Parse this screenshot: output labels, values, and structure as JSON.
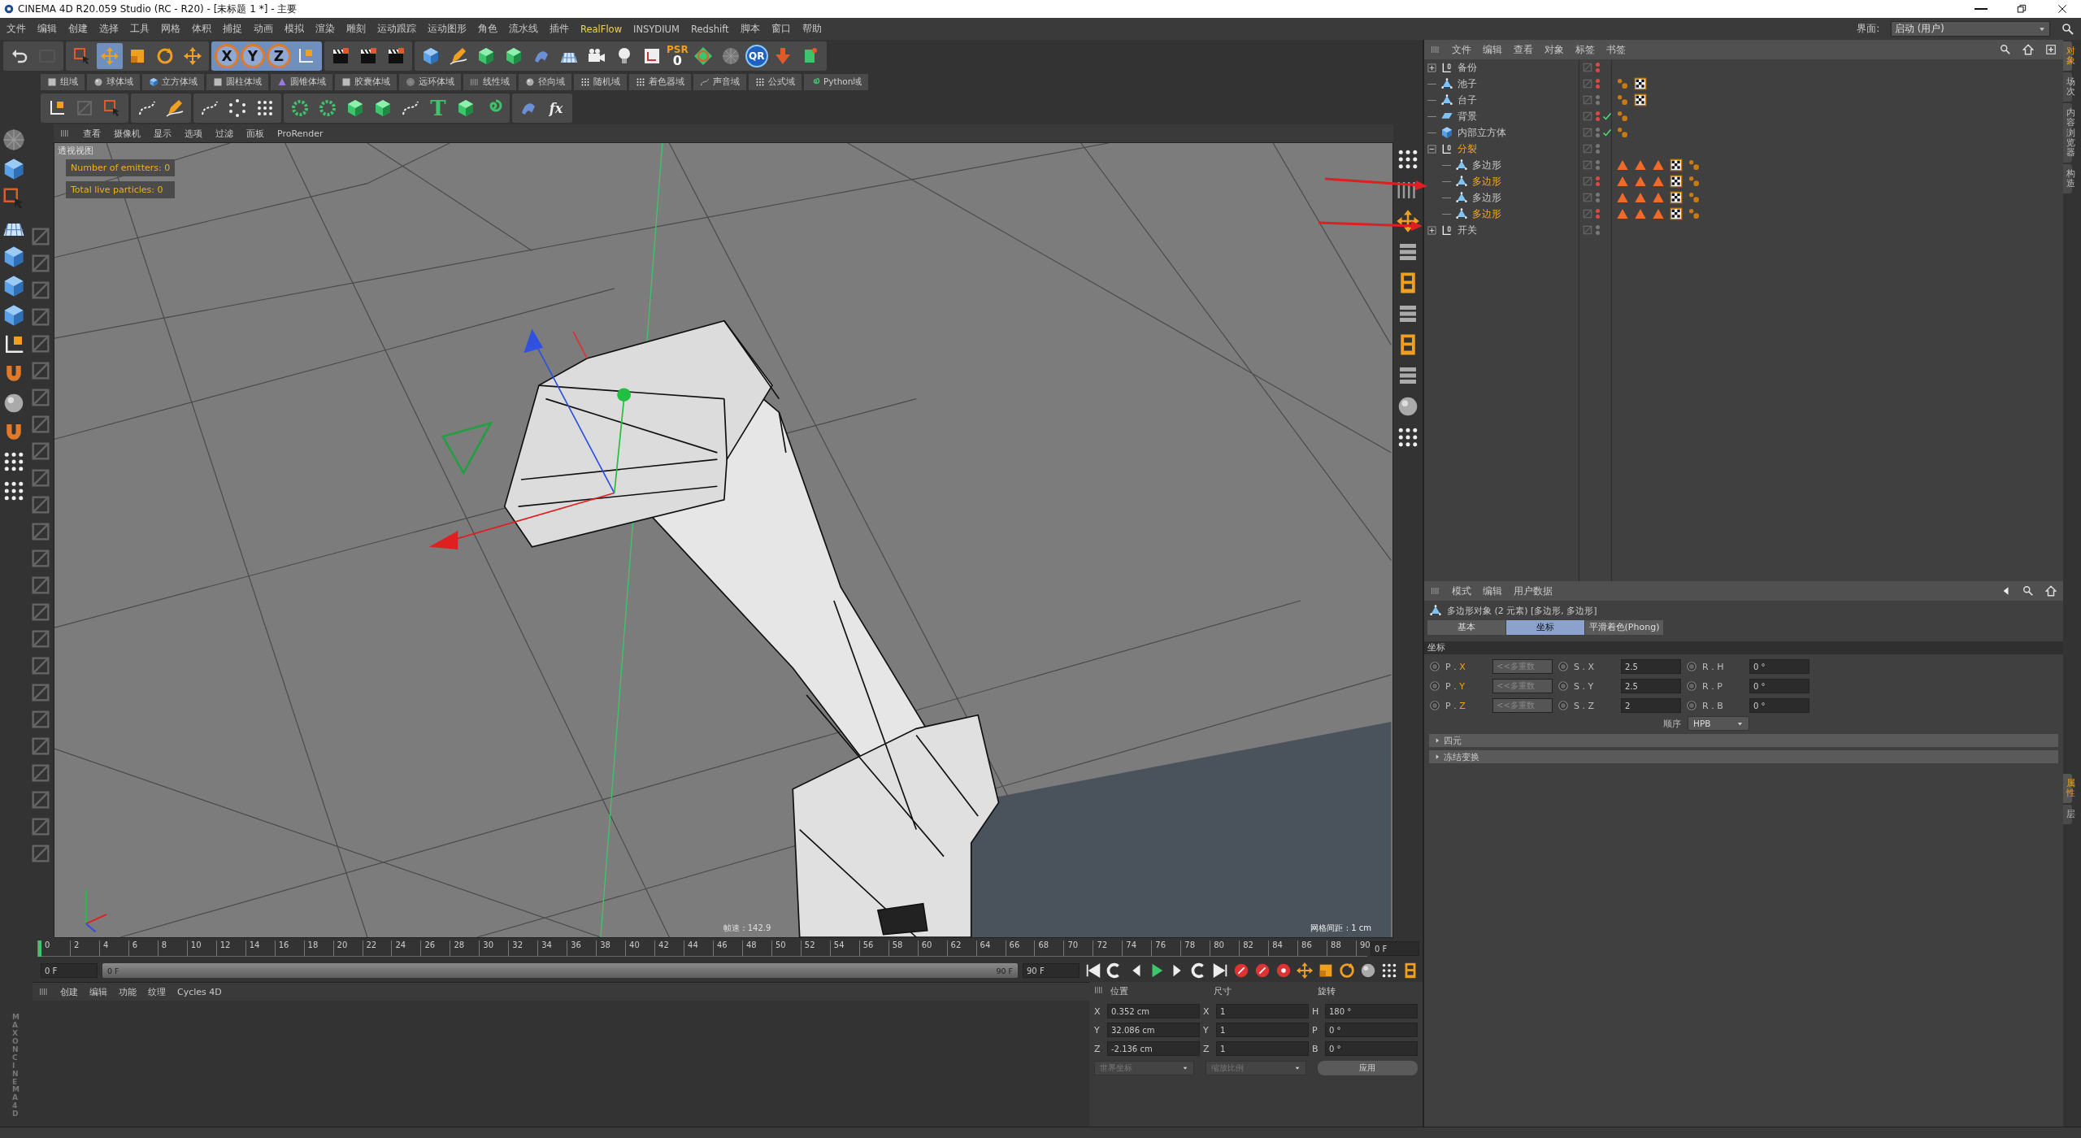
{
  "window": {
    "title": "CINEMA 4D R20.059 Studio (RC - R20) - [未标题 1 *] - 主要"
  },
  "menu": [
    "文件",
    "编辑",
    "创建",
    "选择",
    "工具",
    "网格",
    "体积",
    "捕捉",
    "动画",
    "模拟",
    "渲染",
    "雕刻",
    "运动跟踪",
    "运动图形",
    "角色",
    "流水线",
    "插件",
    "RealFlow",
    "INSYDIUM",
    "Redshift",
    "脚本",
    "窗口",
    "帮助"
  ],
  "layout": {
    "label": "界面:",
    "value": "启动 (用户)"
  },
  "toolbar": {
    "axis_buttons": [
      "X",
      "Y",
      "Z"
    ],
    "psr": "PSR",
    "psr_value": "0",
    "qr": "QR"
  },
  "fields_bar": [
    "组域",
    "球体域",
    "立方体域",
    "圆柱体域",
    "圆锥体域",
    "胶囊体域",
    "远环体域",
    "线性域",
    "径向域",
    "随机域",
    "着色器域",
    "声音域",
    "公式域",
    "Python域"
  ],
  "toolbar2": {
    "text_tool": "T",
    "fx": "fx"
  },
  "viewport": {
    "menu": [
      "查看",
      "摄像机",
      "显示",
      "选项",
      "过滤",
      "面板",
      "ProRender"
    ],
    "view_name": "透视视图",
    "hud": [
      "Number of emitters: 0",
      "Total live particles: 0"
    ],
    "fps": "帧速 : 142.9",
    "grid_spacing": "网格间距 : 1 cm"
  },
  "timeline": {
    "ticks": [
      "0",
      "2",
      "4",
      "6",
      "8",
      "10",
      "12",
      "14",
      "16",
      "18",
      "20",
      "22",
      "24",
      "26",
      "28",
      "30",
      "32",
      "34",
      "36",
      "38",
      "40",
      "42",
      "44",
      "46",
      "48",
      "50",
      "52",
      "54",
      "56",
      "58",
      "60",
      "62",
      "64",
      "66",
      "68",
      "70",
      "72",
      "74",
      "76",
      "78",
      "80",
      "82",
      "84",
      "86",
      "88",
      "90"
    ],
    "current_frame": "0 F",
    "start": "0 F",
    "level": 1,
    "range_start": "0 F",
    "range_end": "90 F",
    "end": "90 F"
  },
  "material_manager": {
    "menu": [
      "创建",
      "编辑",
      "功能",
      "纹理",
      "Cycles 4D"
    ]
  },
  "coordinates": {
    "headers": [
      "位置",
      "尺寸",
      "旋转"
    ],
    "rows": [
      {
        "pos_axis": "X",
        "pos": "0.352 cm",
        "size_axis": "X",
        "size": "1",
        "rot_axis": "H",
        "rot": "180 °"
      },
      {
        "pos_axis": "Y",
        "pos": "32.086 cm",
        "size_axis": "Y",
        "size": "1",
        "rot_axis": "P",
        "rot": "0 °"
      },
      {
        "pos_axis": "Z",
        "pos": "-2.136 cm",
        "size_axis": "Z",
        "size": "1",
        "rot_axis": "B",
        "rot": "0 °"
      }
    ],
    "space": "世界坐标",
    "scale_mode": "缩放比例",
    "apply": "应用"
  },
  "object_manager": {
    "menu": [
      "文件",
      "编辑",
      "查看",
      "对象",
      "标签",
      "书签"
    ],
    "objects": [
      {
        "name": "备份",
        "kind": "null",
        "expanded": false,
        "selected": false,
        "editor": true,
        "render": true,
        "checked": false
      },
      {
        "name": "池子",
        "kind": "polygon",
        "selected": false,
        "editor": true,
        "render": true,
        "checked": false,
        "tags": [
          {
            "kind": "phong"
          },
          {
            "kind": "texture"
          }
        ]
      },
      {
        "name": "台子",
        "kind": "polygon",
        "selected": false,
        "editor": false,
        "render": false,
        "checked": false,
        "tags": [
          {
            "kind": "phong"
          },
          {
            "kind": "texture"
          }
        ]
      },
      {
        "name": "背景",
        "kind": "plane",
        "selected": false,
        "editor": true,
        "render": true,
        "checked": true,
        "tags": [
          {
            "kind": "phong"
          }
        ]
      },
      {
        "name": "内部立方体",
        "kind": "cube",
        "selected": false,
        "editor": false,
        "render": false,
        "checked": true,
        "tags": [
          {
            "kind": "phong"
          }
        ]
      },
      {
        "name": "分裂",
        "kind": "null",
        "expanded": true,
        "selected": true,
        "editor": false,
        "render": false,
        "checked": false,
        "children": [
          {
            "name": "多边形",
            "kind": "polygon",
            "selected": false,
            "editor": false,
            "render": false,
            "checked": false,
            "tags": [
              {
                "kind": "selection"
              },
              {
                "kind": "selection"
              },
              {
                "kind": "selection"
              },
              {
                "kind": "texture"
              },
              {
                "kind": "phong"
              }
            ]
          },
          {
            "name": "多边形",
            "kind": "polygon",
            "selected": true,
            "editor": true,
            "render": true,
            "checked": false,
            "tags": [
              {
                "kind": "selection"
              },
              {
                "kind": "selection"
              },
              {
                "kind": "selection"
              },
              {
                "kind": "texture"
              },
              {
                "kind": "phong"
              }
            ]
          },
          {
            "name": "多边形",
            "kind": "polygon",
            "selected": false,
            "editor": false,
            "render": false,
            "checked": false,
            "tags": [
              {
                "kind": "selection"
              },
              {
                "kind": "selection"
              },
              {
                "kind": "selection"
              },
              {
                "kind": "texture"
              },
              {
                "kind": "phong"
              }
            ]
          },
          {
            "name": "多边形",
            "kind": "polygon",
            "selected": true,
            "editor": true,
            "render": true,
            "checked": false,
            "tags": [
              {
                "kind": "selection"
              },
              {
                "kind": "selection"
              },
              {
                "kind": "selection"
              },
              {
                "kind": "texture"
              },
              {
                "kind": "phong"
              }
            ]
          }
        ]
      },
      {
        "name": "开关",
        "kind": "null",
        "expanded": false,
        "selected": false,
        "editor": false,
        "render": false,
        "checked": false
      }
    ],
    "side_tabs": [
      {
        "label": "对象",
        "selected": true
      },
      {
        "label": "场次",
        "selected": false
      },
      {
        "label": "内容浏览器",
        "selected": false
      },
      {
        "label": "构造",
        "selected": false
      }
    ]
  },
  "attributes": {
    "menu": [
      "模式",
      "编辑",
      "用户数据"
    ],
    "title": "多边形对象 (2 元素) [多边形, 多边形]",
    "tabs": [
      {
        "label": "基本",
        "selected": false
      },
      {
        "label": "坐标",
        "selected": true
      },
      {
        "label": "平滑着色(Phong)",
        "selected": false
      }
    ],
    "section": "坐标",
    "rows": [
      {
        "p_label": "P .",
        "p_axis": "X",
        "p_value": "<<多重数",
        "s_label": "S . X",
        "s_value": "2.5",
        "r_label": "R . H",
        "r_value": "0 °"
      },
      {
        "p_label": "P .",
        "p_axis": "Y",
        "p_value": "<<多重数",
        "s_label": "S . Y",
        "s_value": "2.5",
        "r_label": "R . P",
        "r_value": "0 °"
      },
      {
        "p_label": "P .",
        "p_axis": "Z",
        "p_value": "<<多重数",
        "s_label": "S . Z",
        "s_value": "2",
        "r_label": "R . B",
        "r_value": "0 °"
      }
    ],
    "order_label": "顺序",
    "order": "HPB",
    "groups": [
      "四元",
      "冻结变换"
    ],
    "side_tabs": [
      {
        "label": "属性",
        "selected": true
      },
      {
        "label": "层",
        "selected": false
      }
    ]
  },
  "logo": "MAXON CINEMA 4D"
}
